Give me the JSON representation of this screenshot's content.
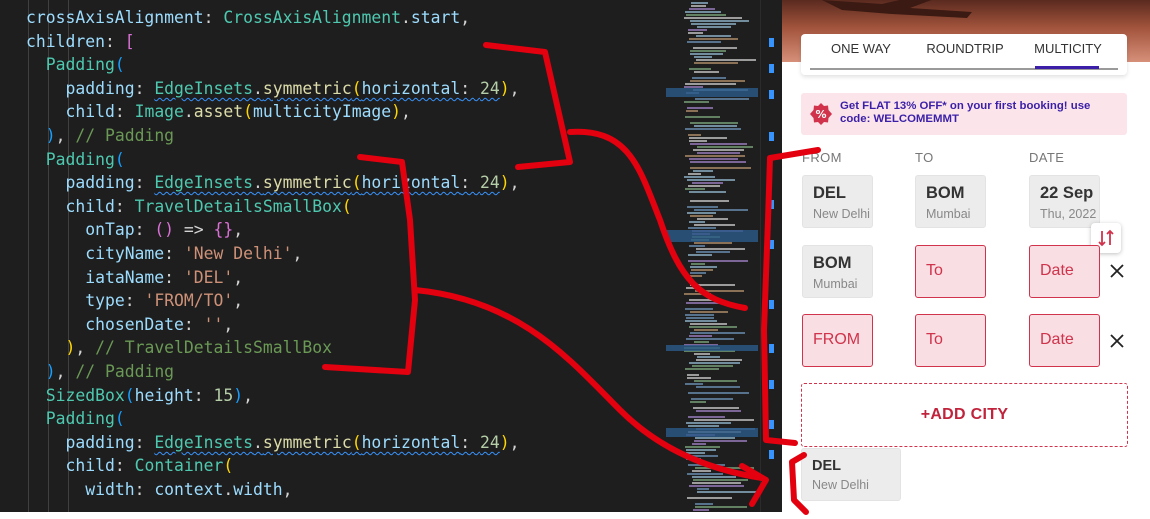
{
  "editor": {
    "lines": [
      [
        {
          "t": "crossAxisAlignment",
          "c": "t-prop"
        },
        {
          "t": ": "
        },
        {
          "t": "CrossAxisAlignment",
          "c": "t-cls"
        },
        {
          "t": "."
        },
        {
          "t": "start",
          "c": "t-prop"
        },
        {
          "t": ","
        }
      ],
      [
        {
          "t": "children",
          "c": "t-prop"
        },
        {
          "t": ": "
        },
        {
          "t": "[",
          "c": "t-b2"
        }
      ],
      [
        {
          "t": "  "
        },
        {
          "t": "Padding",
          "c": "t-cls"
        },
        {
          "t": "(",
          "c": "t-b3"
        }
      ],
      [
        {
          "t": "    "
        },
        {
          "t": "padding",
          "c": "t-prop"
        },
        {
          "t": ": "
        },
        {
          "t": "EdgeInsets",
          "c": "t-cls squig"
        },
        {
          "t": ".",
          "c": "squig"
        },
        {
          "t": "symmetric",
          "c": "t-fn squig"
        },
        {
          "t": "(",
          "c": "t-b1 squig"
        },
        {
          "t": "horizontal",
          "c": "t-prop squig"
        },
        {
          "t": ": ",
          "c": "squig"
        },
        {
          "t": "24",
          "c": "t-num squig"
        },
        {
          "t": ")",
          "c": "t-b1"
        },
        {
          "t": ","
        }
      ],
      [
        {
          "t": "    "
        },
        {
          "t": "child",
          "c": "t-prop"
        },
        {
          "t": ": "
        },
        {
          "t": "Image",
          "c": "t-cls"
        },
        {
          "t": "."
        },
        {
          "t": "asset",
          "c": "t-fn"
        },
        {
          "t": "(",
          "c": "t-b1"
        },
        {
          "t": "multicityImage",
          "c": "t-prop"
        },
        {
          "t": ")",
          "c": "t-b1"
        },
        {
          "t": ","
        }
      ],
      [
        {
          "t": "  "
        },
        {
          "t": ")",
          "c": "t-b3"
        },
        {
          "t": ", "
        },
        {
          "t": "// Padding",
          "c": "t-cmt"
        }
      ],
      [
        {
          "t": "  "
        },
        {
          "t": "Padding",
          "c": "t-cls"
        },
        {
          "t": "(",
          "c": "t-b3"
        }
      ],
      [
        {
          "t": "    "
        },
        {
          "t": "padding",
          "c": "t-prop"
        },
        {
          "t": ": "
        },
        {
          "t": "EdgeInsets",
          "c": "t-cls squig"
        },
        {
          "t": ".",
          "c": "squig"
        },
        {
          "t": "symmetric",
          "c": "t-fn squig"
        },
        {
          "t": "(",
          "c": "t-b1 squig"
        },
        {
          "t": "horizontal",
          "c": "t-prop squig"
        },
        {
          "t": ": ",
          "c": "squig"
        },
        {
          "t": "24",
          "c": "t-num squig"
        },
        {
          "t": ")",
          "c": "t-b1"
        },
        {
          "t": ","
        }
      ],
      [
        {
          "t": "    "
        },
        {
          "t": "child",
          "c": "t-prop"
        },
        {
          "t": ": "
        },
        {
          "t": "TravelDetailsSmallBox",
          "c": "t-cls"
        },
        {
          "t": "(",
          "c": "t-b1"
        }
      ],
      [
        {
          "t": "      "
        },
        {
          "t": "onTap",
          "c": "t-prop"
        },
        {
          "t": ": "
        },
        {
          "t": "()",
          "c": "t-b2"
        },
        {
          "t": " => "
        },
        {
          "t": "{}",
          "c": "t-b2"
        },
        {
          "t": ","
        }
      ],
      [
        {
          "t": "      "
        },
        {
          "t": "cityName",
          "c": "t-prop"
        },
        {
          "t": ": "
        },
        {
          "t": "'New Delhi'",
          "c": "t-str"
        },
        {
          "t": ","
        }
      ],
      [
        {
          "t": "      "
        },
        {
          "t": "iataName",
          "c": "t-prop"
        },
        {
          "t": ": "
        },
        {
          "t": "'DEL'",
          "c": "t-str"
        },
        {
          "t": ","
        }
      ],
      [
        {
          "t": "      "
        },
        {
          "t": "type",
          "c": "t-prop"
        },
        {
          "t": ": "
        },
        {
          "t": "'FROM/TO'",
          "c": "t-str"
        },
        {
          "t": ","
        }
      ],
      [
        {
          "t": "      "
        },
        {
          "t": "chosenDate",
          "c": "t-prop"
        },
        {
          "t": ": "
        },
        {
          "t": "''",
          "c": "t-str"
        },
        {
          "t": ","
        }
      ],
      [
        {
          "t": "    "
        },
        {
          "t": ")",
          "c": "t-b1"
        },
        {
          "t": ", "
        },
        {
          "t": "// TravelDetailsSmallBox",
          "c": "t-cmt"
        }
      ],
      [
        {
          "t": "  "
        },
        {
          "t": ")",
          "c": "t-b3"
        },
        {
          "t": ", "
        },
        {
          "t": "// Padding",
          "c": "t-cmt"
        }
      ],
      [
        {
          "t": "  "
        },
        {
          "t": "SizedBox",
          "c": "t-cls"
        },
        {
          "t": "(",
          "c": "t-b3"
        },
        {
          "t": "height",
          "c": "t-prop"
        },
        {
          "t": ": "
        },
        {
          "t": "15",
          "c": "t-num"
        },
        {
          "t": ")",
          "c": "t-b3"
        },
        {
          "t": ","
        }
      ],
      [
        {
          "t": "  "
        },
        {
          "t": "Padding",
          "c": "t-cls"
        },
        {
          "t": "(",
          "c": "t-b3"
        }
      ],
      [
        {
          "t": "    "
        },
        {
          "t": "padding",
          "c": "t-prop"
        },
        {
          "t": ": "
        },
        {
          "t": "EdgeInsets",
          "c": "t-cls squig"
        },
        {
          "t": ".",
          "c": "squig"
        },
        {
          "t": "symmetric",
          "c": "t-fn squig"
        },
        {
          "t": "(",
          "c": "t-b1 squig"
        },
        {
          "t": "horizontal",
          "c": "t-prop squig"
        },
        {
          "t": ": ",
          "c": "squig"
        },
        {
          "t": "24",
          "c": "t-num squig"
        },
        {
          "t": ")",
          "c": "t-b1"
        },
        {
          "t": ","
        }
      ],
      [
        {
          "t": "    "
        },
        {
          "t": "child",
          "c": "t-prop"
        },
        {
          "t": ": "
        },
        {
          "t": "Container",
          "c": "t-cls"
        },
        {
          "t": "(",
          "c": "t-b1"
        }
      ],
      [
        {
          "t": "      "
        },
        {
          "t": "width",
          "c": "t-prop"
        },
        {
          "t": ": "
        },
        {
          "t": "context",
          "c": "t-prop"
        },
        {
          "t": "."
        },
        {
          "t": "width",
          "c": "t-prop"
        },
        {
          "t": ","
        }
      ]
    ]
  },
  "app": {
    "tabs": [
      "ONE WAY",
      "ROUNDTRIP",
      "MULTICITY"
    ],
    "active_tab": "MULTICITY",
    "offer": "Get FLAT 13% OFF* on your first booking! use code: WELCOMEMMT",
    "offer_icon": "discount-badge-icon",
    "columns": [
      "FROM",
      "TO",
      "DATE"
    ],
    "row1": {
      "from_code": "DEL",
      "from_city": "New Delhi",
      "to_code": "BOM",
      "to_city": "Mumbai",
      "date_main": "22 Sep",
      "date_sub": "Thu, 2022"
    },
    "row2": {
      "from_code": "BOM",
      "from_city": "Mumbai",
      "to_placeholder": "To",
      "date_placeholder": "Date"
    },
    "row3": {
      "from_placeholder": "FROM",
      "to_placeholder": "To",
      "date_placeholder": "Date"
    },
    "add_city": "+ADD  CITY",
    "preview": {
      "code": "DEL",
      "city": "New Delhi"
    },
    "colors": {
      "accent": "#3b1fa8",
      "error": "#d0334b",
      "annotation": "#e3000f"
    }
  }
}
